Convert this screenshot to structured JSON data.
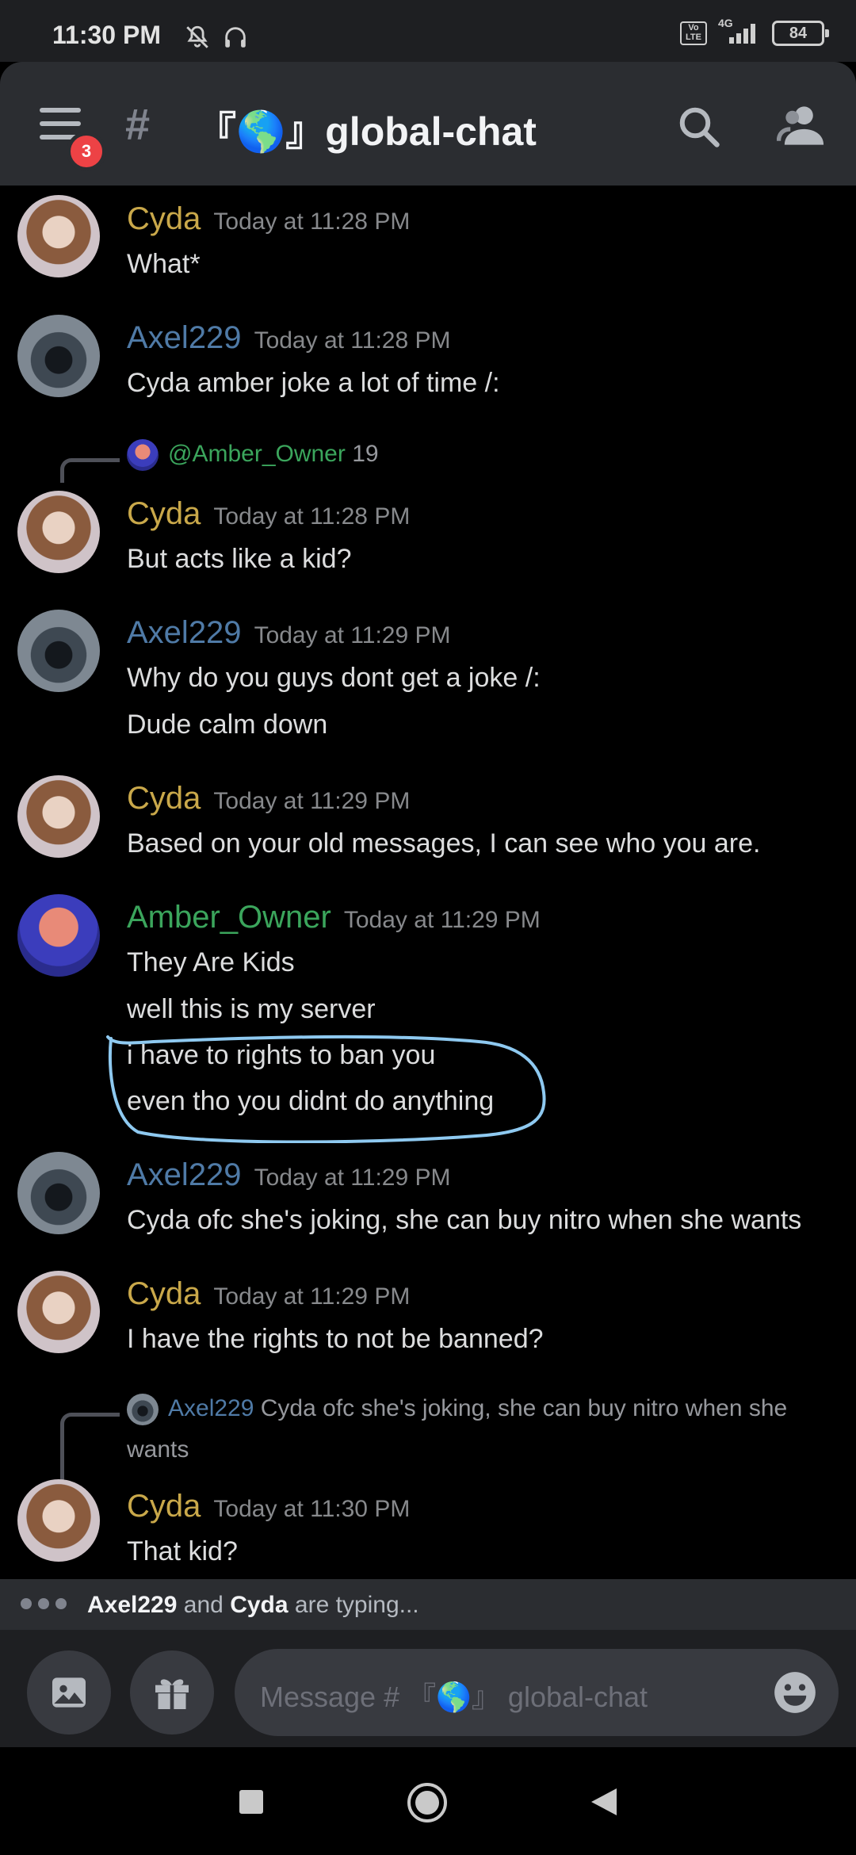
{
  "status_bar": {
    "time": "11:30 PM",
    "network": "4G",
    "volte": "Vo LTE",
    "battery": "84"
  },
  "header": {
    "notification_count": "3",
    "hash": "#",
    "channel_name": "『🌎』global-chat"
  },
  "messages": [
    {
      "author": "Cyda",
      "timestamp": "Today at 11:28 PM",
      "lines": [
        "What*"
      ]
    },
    {
      "author": "Axel229",
      "timestamp": "Today at 11:28 PM",
      "lines": [
        "Cyda amber joke a lot of time /:"
      ]
    },
    {
      "reply": {
        "author": "@Amber_Owner",
        "text": "19"
      },
      "author": "Cyda",
      "timestamp": "Today at 11:28 PM",
      "lines": [
        "But acts like a kid?"
      ]
    },
    {
      "author": "Axel229",
      "timestamp": "Today at 11:29 PM",
      "lines": [
        "Why do you guys dont get a joke /:",
        "Dude calm down"
      ]
    },
    {
      "author": "Cyda",
      "timestamp": "Today at 11:29 PM",
      "lines": [
        "Based on your old messages, I can see who you are."
      ]
    },
    {
      "author": "Amber_Owner",
      "timestamp": "Today at 11:29 PM",
      "lines": [
        "They Are Kids",
        "well this is my server",
        "i have to rights to ban you",
        "even tho you didnt do anything"
      ]
    },
    {
      "author": "Axel229",
      "timestamp": "Today at 11:29 PM",
      "lines": [
        "Cyda ofc she's joking, she can buy nitro when she wants"
      ]
    },
    {
      "author": "Cyda",
      "timestamp": "Today at 11:29 PM",
      "lines": [
        "I have the rights to not be banned?"
      ]
    },
    {
      "reply": {
        "author": "Axel229",
        "text": "Cyda ofc she's joking, she can buy nitro when she",
        "text2": "wants"
      },
      "author": "Cyda",
      "timestamp": "Today at 11:30 PM",
      "lines": [
        "That kid?"
      ]
    }
  ],
  "typing": {
    "user1": "Axel229",
    "joiner": "and",
    "user2": "Cyda",
    "suffix": "are typing..."
  },
  "composer": {
    "placeholder": "Message # 『🌎』 global-chat"
  },
  "colors": {
    "cyda": "#c9a84a",
    "axel229": "#4f7aa6",
    "amber_owner": "#3ba55c",
    "highlight_annotation": "#8ec9f0"
  }
}
